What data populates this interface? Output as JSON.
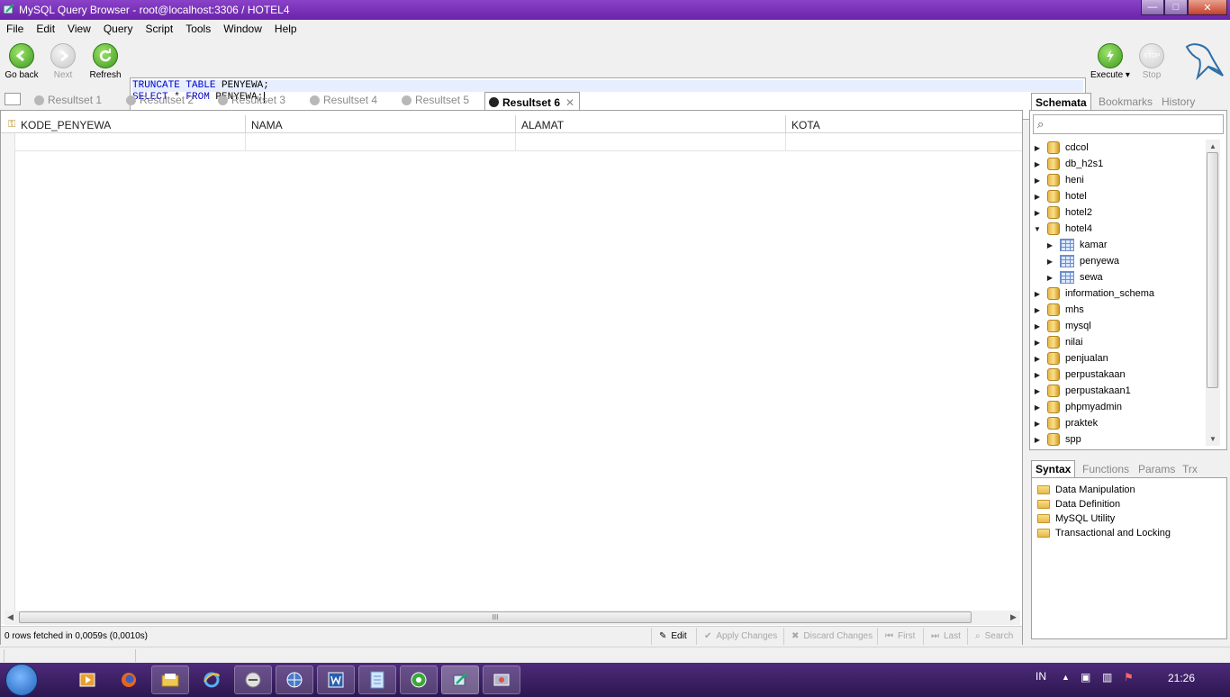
{
  "window": {
    "title": "MySQL Query Browser - root@localhost:3306 / HOTEL4",
    "min_glyph": "—",
    "max_glyph": "□",
    "close_glyph": "✕"
  },
  "menu": [
    "File",
    "Edit",
    "View",
    "Query",
    "Script",
    "Tools",
    "Window",
    "Help"
  ],
  "toolbar": {
    "go_back": "Go back",
    "next": "Next",
    "refresh": "Refresh",
    "execute": "Execute",
    "stop": "Stop",
    "stop_badge": "STOP"
  },
  "editor": {
    "line1_kw": "TRUNCATE TABLE",
    "line1_rest": " PENYEWA;",
    "line2_kw1": "SELECT",
    "line2_mid": " * ",
    "line2_kw2": "FROM",
    "line2_rest": " PENYEWA;"
  },
  "result_tabs": [
    "Resultset 1",
    "Resultset 2",
    "Resultset 3",
    "Resultset 4",
    "Resultset 5",
    "Resultset 6"
  ],
  "active_result_tab": "Resultset 6",
  "grid": {
    "columns": [
      "KODE_PENYEWA",
      "NAMA",
      "ALAMAT",
      "KOTA"
    ],
    "status": "0 rows fetched in 0,0059s (0,0010s)",
    "scroll_grip": "III"
  },
  "grid_buttons": {
    "edit": "Edit",
    "apply": "Apply Changes",
    "discard": "Discard Changes",
    "first": "First",
    "last": "Last",
    "search": "Search"
  },
  "schema_tabs": {
    "schemata": "Schemata",
    "bookmarks": "Bookmarks",
    "history": "History"
  },
  "schemata": [
    "cdcol",
    "db_h2s1",
    "heni",
    "hotel",
    "hotel2",
    "hotel4",
    "information_schema",
    "mhs",
    "mysql",
    "nilai",
    "penjualan",
    "perpustakaan",
    "perpustakaan1",
    "phpmyadmin",
    "praktek",
    "spp"
  ],
  "hotel4_tables": [
    "kamar",
    "penyewa",
    "sewa"
  ],
  "syntax_tabs": {
    "syntax": "Syntax",
    "functions": "Functions",
    "params": "Params",
    "trx": "Trx"
  },
  "syntax_items": [
    "Data Manipulation",
    "Data Definition",
    "MySQL Utility",
    "Transactional and Locking"
  ],
  "taskbar": {
    "lang": "IN",
    "clock": "21:26"
  }
}
